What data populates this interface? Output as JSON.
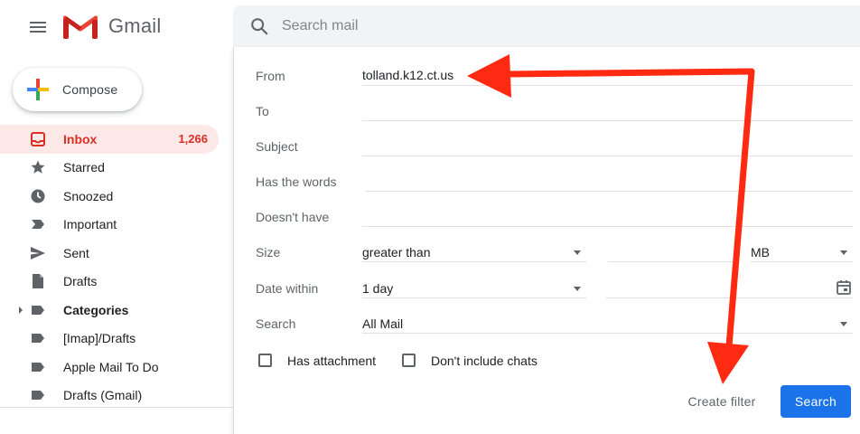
{
  "app": {
    "name": "Gmail"
  },
  "search": {
    "placeholder": "Search mail"
  },
  "compose": {
    "label": "Compose"
  },
  "sidebar": {
    "items": [
      {
        "label": "Inbox",
        "count": "1,266",
        "icon": "inbox-icon",
        "active": true
      },
      {
        "label": "Starred",
        "icon": "star-icon"
      },
      {
        "label": "Snoozed",
        "icon": "clock-icon"
      },
      {
        "label": "Important",
        "icon": "important-icon"
      },
      {
        "label": "Sent",
        "icon": "send-icon"
      },
      {
        "label": "Drafts",
        "icon": "draft-icon"
      },
      {
        "label": "Categories",
        "icon": "label-icon",
        "expandable": true
      },
      {
        "label": "[Imap]/Drafts",
        "icon": "label-icon"
      },
      {
        "label": "Apple Mail To Do",
        "icon": "label-icon"
      },
      {
        "label": "Drafts (Gmail)",
        "icon": "label-icon"
      }
    ]
  },
  "filter": {
    "from": {
      "label": "From",
      "value": "tolland.k12.ct.us"
    },
    "to": {
      "label": "To",
      "value": ""
    },
    "subject": {
      "label": "Subject",
      "value": ""
    },
    "has_words": {
      "label": "Has the words",
      "value": ""
    },
    "doesnt_have": {
      "label": "Doesn't have",
      "value": ""
    },
    "size": {
      "label": "Size",
      "comparator": "greater than",
      "value": "",
      "unit": "MB"
    },
    "date_within": {
      "label": "Date within",
      "value": "1 day",
      "date": ""
    },
    "search_in": {
      "label": "Search",
      "value": "All Mail"
    },
    "has_attachment": {
      "label": "Has attachment",
      "checked": false
    },
    "dont_include_chats": {
      "label": "Don't include chats",
      "checked": false
    },
    "create_filter_label": "Create filter",
    "search_button_label": "Search"
  },
  "colors": {
    "accent": "#1a73e8",
    "inbox_active_bg": "#fce8e6",
    "inbox_active_text": "#d93025",
    "annotation_arrow": "#ff2a12"
  }
}
